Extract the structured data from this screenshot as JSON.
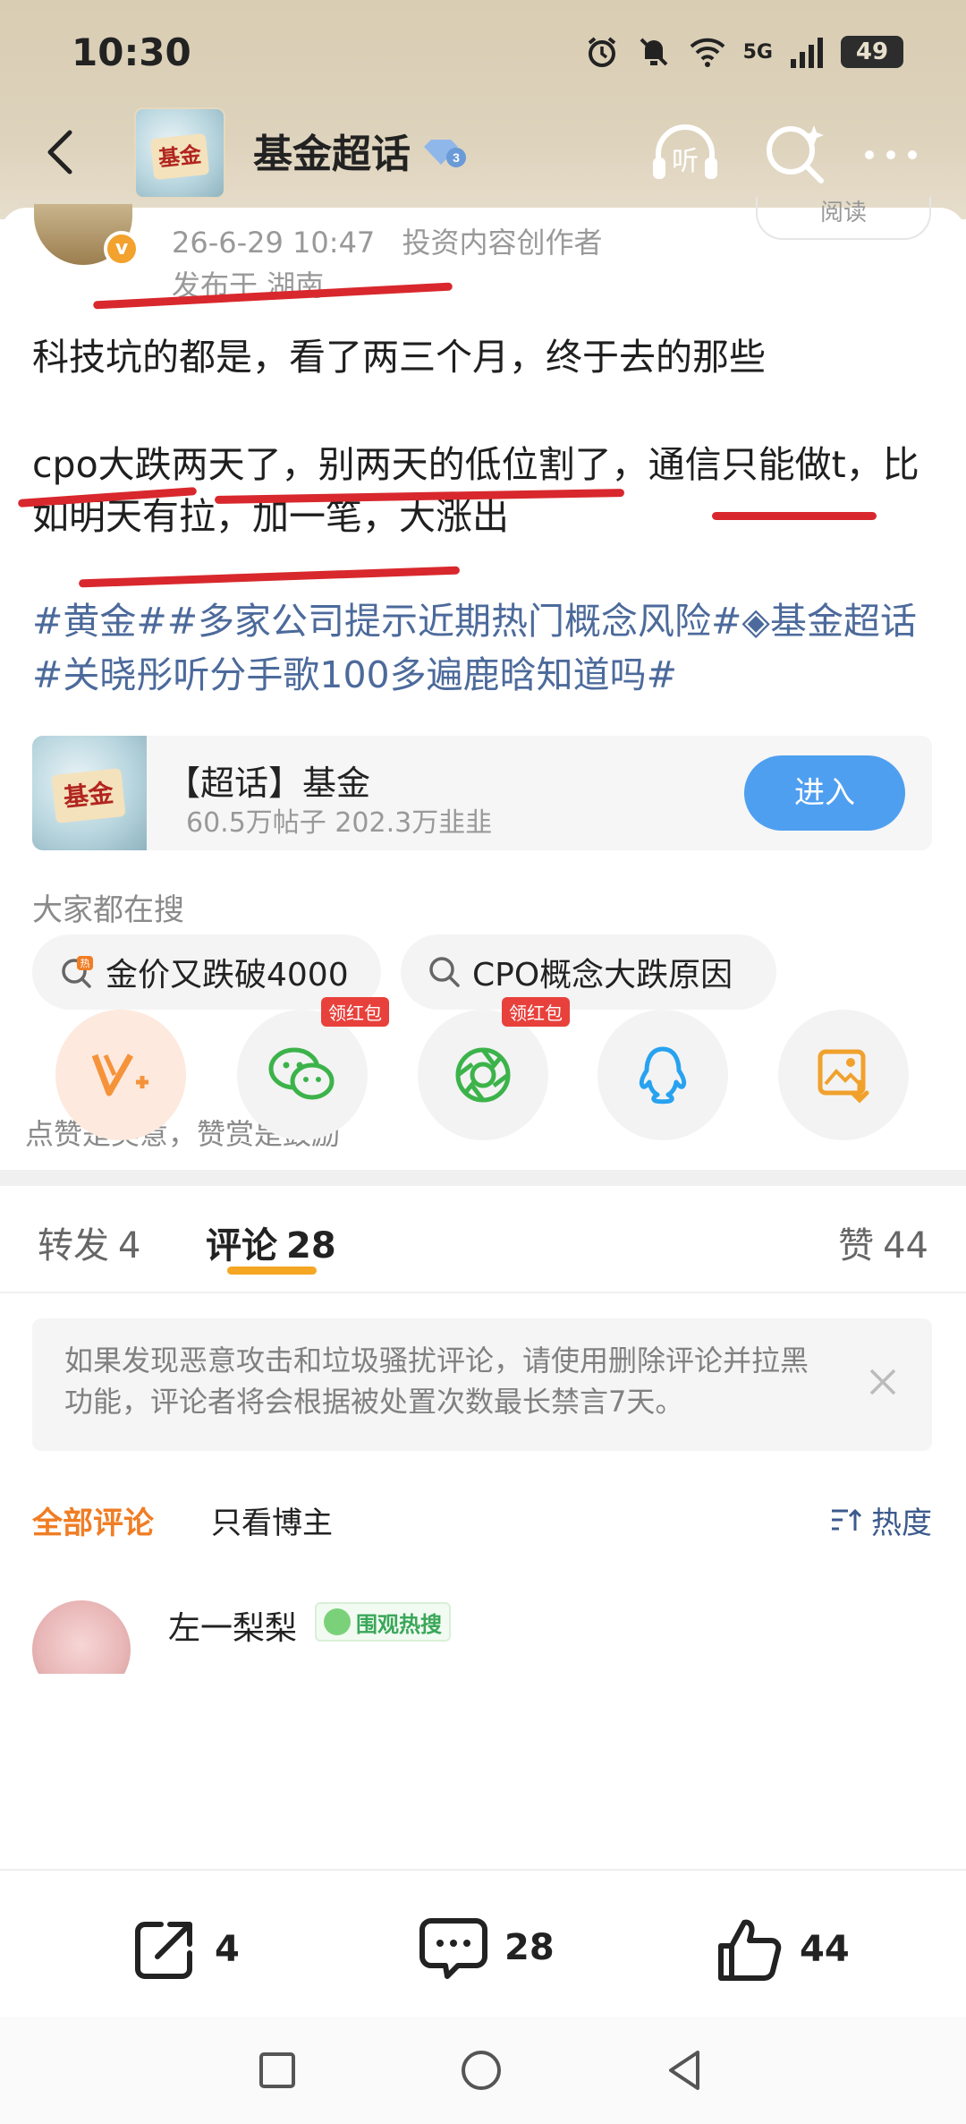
{
  "status_bar": {
    "time": "10:30",
    "network": "5G",
    "network_sub": "6",
    "battery": "49",
    "icons": [
      "alarm-icon",
      "mute-icon",
      "wifi-icon",
      "signal-icon",
      "battery-icon"
    ]
  },
  "nav": {
    "title": "基金超话",
    "avatar_text": "基金",
    "listen_label": "听",
    "icons": [
      "back-icon",
      "diamond-level-icon",
      "listen-icon",
      "search-icon",
      "more-icon"
    ]
  },
  "post": {
    "author_avatar_text": "",
    "read_label": "阅读",
    "time": "26-6-29 10:47",
    "role": "投资内容创作者",
    "location": "发布于 湖南",
    "paragraph1": "科技坑的都是，看了两三个月，终于去的那些",
    "paragraph2": "cpo大跌两天了，别两天的低位割了，通信只能做t，比如明天有拉，加一笔，大涨出",
    "hashtags": "#黄金##多家公司提示近期热门概念风险#◈基金超话 #关晓彤听分手歌100多遍鹿晗知道吗#"
  },
  "topic_card": {
    "name": "【超话】基金",
    "stats": "60.5万帖子 202.3万韭韭",
    "enter_label": "进入",
    "thumb_text": "基金"
  },
  "search": {
    "title": "大家都在搜",
    "chips": [
      {
        "label": "金价又跌破4000",
        "icon": "hot-search-icon"
      },
      {
        "label": "CPO概念大跌原因",
        "icon": "search-icon"
      }
    ]
  },
  "reward": {
    "tip": "点赞是美意，赞赏是鼓励",
    "red_packet_tag": "领红包"
  },
  "tabs": {
    "repost": {
      "label": "转发",
      "count": "4"
    },
    "comments": {
      "label": "评论",
      "count": "28"
    },
    "likes": {
      "label": "赞",
      "count": "44"
    }
  },
  "notice": {
    "text": "如果发现恶意攻击和垃圾骚扰评论，请使用删除评论并拉黑功能，评论者将会根据被处置次数最长禁言7天。"
  },
  "filters": {
    "all": "全部评论",
    "owner_only": "只看博主",
    "sort": "热度"
  },
  "comment_preview": {
    "name": "左一梨梨",
    "badge": "围观热搜"
  },
  "action_bar": {
    "repost_count": "4",
    "comment_count": "28",
    "like_count": "44"
  },
  "colors": {
    "accent_orange": "#f07d24",
    "tab_underline": "#f5a623",
    "link_blue": "#4c6a9b",
    "enter_button": "#4f9ff0",
    "annotation_red": "#d8282d"
  }
}
